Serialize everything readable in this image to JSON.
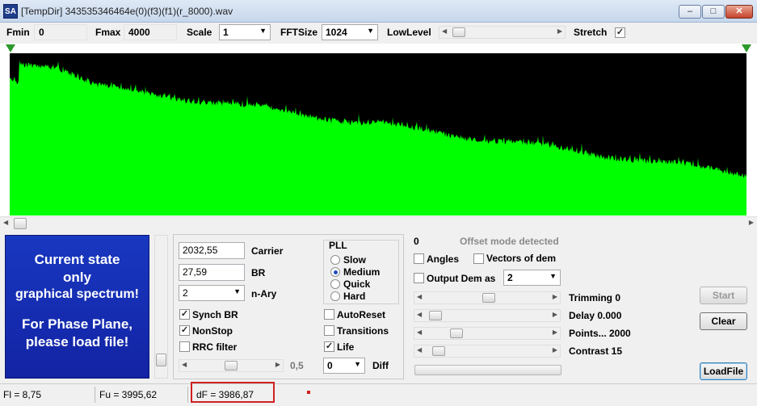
{
  "window": {
    "app_icon": "SA",
    "title": "[TempDir] 343535346464e(0)(f3)(f1)(r_8000).wav",
    "min_icon": "minimize-icon",
    "max_icon": "maximize-icon",
    "close_icon": "close-icon"
  },
  "toolbar": {
    "fmin_label": "Fmin",
    "fmin_value": "0",
    "fmax_label": "Fmax",
    "fmax_value": "4000",
    "scale_label": "Scale",
    "scale_value": "1",
    "fftsize_label": "FFTSize",
    "fftsize_value": "1024",
    "lowlevel_label": "LowLevel",
    "lowlevel_position": 0.07,
    "stretch_label": "Stretch",
    "stretch_checked": true
  },
  "spectrum": {
    "color": "#00ff00",
    "background": "#000000",
    "marker_color": "#2e9a2e"
  },
  "info_panel": {
    "line1": "Current state",
    "line2": "only",
    "line3": "graphical spectrum!",
    "line4": "For Phase Plane,",
    "line5": "please load file!",
    "background": "#1630b8"
  },
  "demod": {
    "carrier_value": "2032,55",
    "carrier_label": "Carrier",
    "br_value": "27,59",
    "br_label": "BR",
    "nary_value": "2",
    "nary_label": "n-Ary",
    "pll_title": "PLL",
    "pll_options": [
      "Slow",
      "Medium",
      "Quick",
      "Hard"
    ],
    "pll_selected": "Medium",
    "synch_br": "Synch BR",
    "nonstop": "NonStop",
    "rrc_filter": "RRC filter",
    "autoreset": "AutoReset",
    "transitions": "Transitions",
    "life": "Life",
    "slider_value": "0,5",
    "diff_value": "0",
    "diff_label": "Diff"
  },
  "right_panel": {
    "counter": "0",
    "offset_mode": "Offset mode detected",
    "angles": "Angles",
    "vectors": "Vectors of dem",
    "output_dem": "Output Dem as",
    "output_dem_value": "2",
    "trimming": "Trimming 0",
    "trimming_position": 0.45,
    "delay": "Delay  0.000",
    "delay_position": 0.08,
    "points": "Points... 2000",
    "points_position": 0.25,
    "contrast": "Contrast 15",
    "contrast_position": 0.1,
    "start_label": "Start",
    "clear_label": "Clear",
    "loadfile_label": "LoadFile"
  },
  "status": {
    "fl": "Fl = 8,75",
    "fu": "Fu = 3995,62",
    "df": "dF = 3986,87",
    "highlight_color": "#d02020"
  }
}
